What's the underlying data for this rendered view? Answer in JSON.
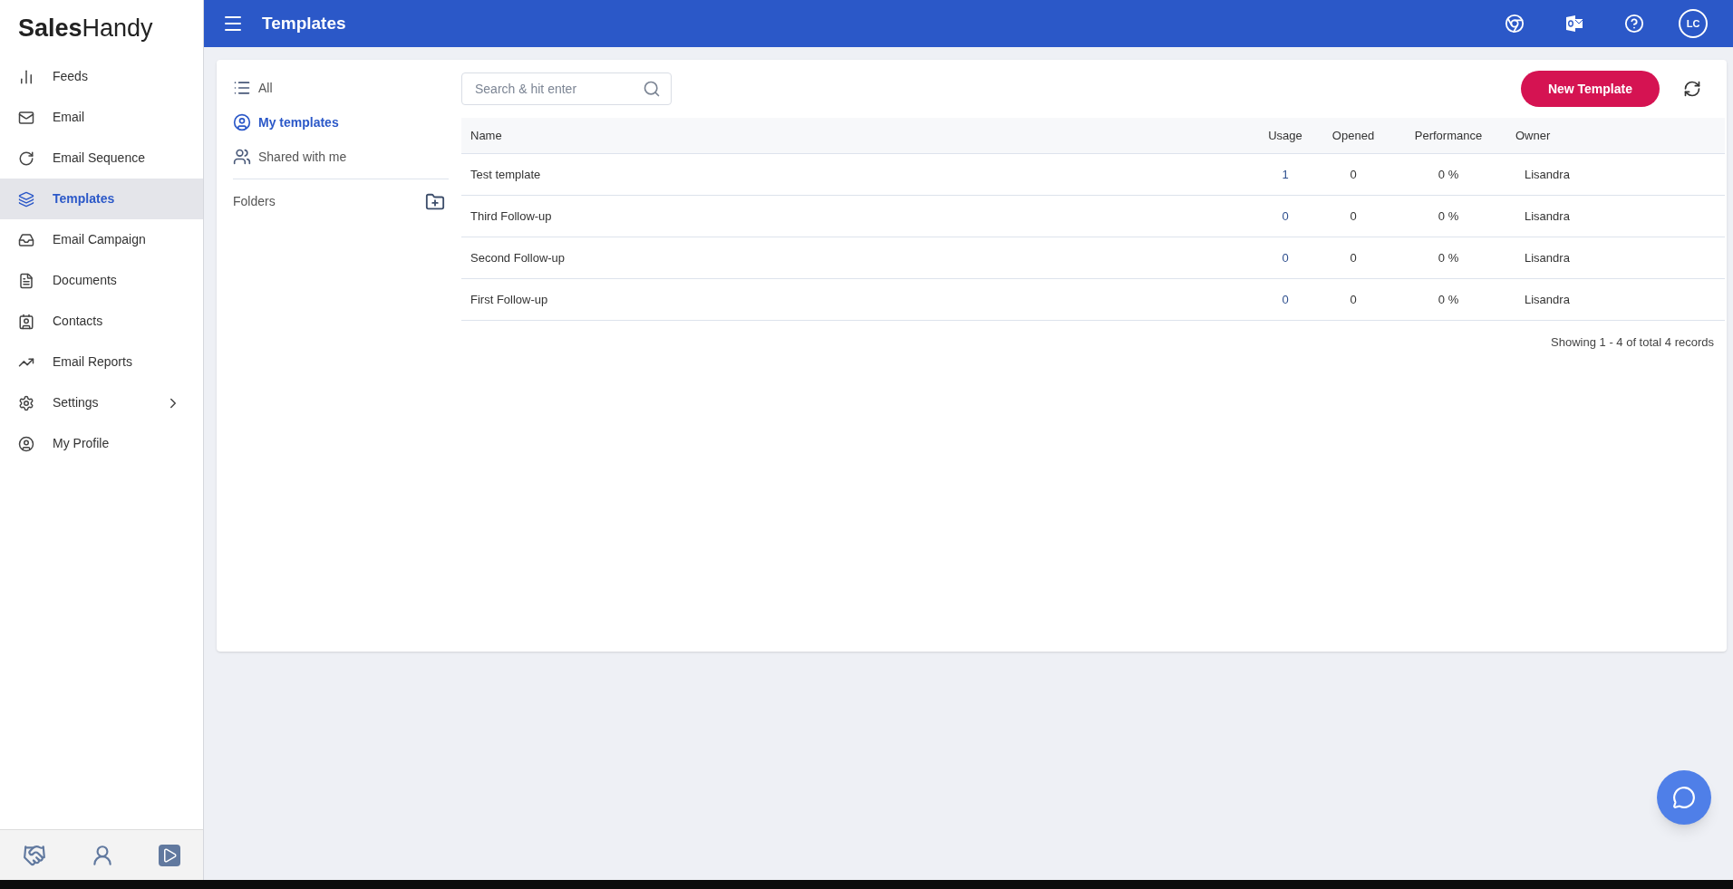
{
  "logo": {
    "bold": "Sales",
    "light": "Handy"
  },
  "sidebar": {
    "items": [
      {
        "label": "Feeds",
        "selected": false,
        "expandable": false
      },
      {
        "label": "Email",
        "selected": false,
        "expandable": false
      },
      {
        "label": "Email Sequence",
        "selected": false,
        "expandable": false
      },
      {
        "label": "Templates",
        "selected": true,
        "expandable": false
      },
      {
        "label": "Email Campaign",
        "selected": false,
        "expandable": false
      },
      {
        "label": "Documents",
        "selected": false,
        "expandable": false
      },
      {
        "label": "Contacts",
        "selected": false,
        "expandable": false
      },
      {
        "label": "Email Reports",
        "selected": false,
        "expandable": false
      },
      {
        "label": "Settings",
        "selected": false,
        "expandable": true
      },
      {
        "label": "My Profile",
        "selected": false,
        "expandable": false
      }
    ]
  },
  "header": {
    "title": "Templates",
    "avatar": "LC"
  },
  "filters": {
    "items": [
      {
        "label": "All",
        "selected": false
      },
      {
        "label": "My templates",
        "selected": true
      },
      {
        "label": "Shared with me",
        "selected": false
      }
    ],
    "folders_label": "Folders"
  },
  "search": {
    "placeholder": "Search & hit enter"
  },
  "new_button": "New Template",
  "table": {
    "columns": [
      "Name",
      "Usage",
      "Opened",
      "Performance",
      "Owner"
    ],
    "rows": [
      [
        "Test template",
        "1",
        "0",
        "0 %",
        "Lisandra"
      ],
      [
        "Third Follow-up",
        "0",
        "0",
        "0 %",
        "Lisandra"
      ],
      [
        "Second Follow-up",
        "0",
        "0",
        "0 %",
        "Lisandra"
      ],
      [
        "First Follow-up",
        "0",
        "0",
        "0 %",
        "Lisandra"
      ]
    ]
  },
  "footer": "Showing 1 - 4 of total 4 records"
}
